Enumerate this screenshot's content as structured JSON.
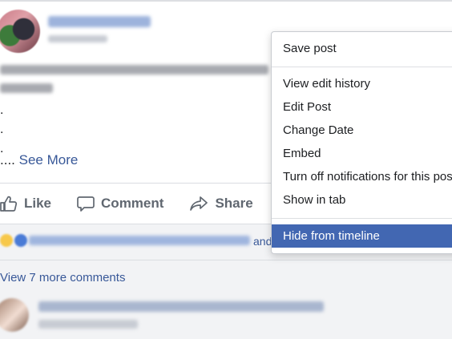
{
  "post": {
    "dots": [
      ".",
      ".",
      "."
    ],
    "ellipsis": "....",
    "see_more": "See More"
  },
  "actions": {
    "like": "Like",
    "comment": "Comment",
    "share": "Share"
  },
  "reactions": {
    "and_text": "and"
  },
  "comments": {
    "view_more": "View 7 more comments"
  },
  "menu": {
    "items": [
      "Save post",
      "View edit history",
      "Edit Post",
      "Change Date",
      "Embed",
      "Turn off notifications for this post",
      "Show in tab",
      "Hide from timeline"
    ],
    "selected": "Hide from timeline"
  },
  "colors": {
    "link": "#385898",
    "menu_highlight": "#4267b2",
    "action_text": "#606770"
  }
}
